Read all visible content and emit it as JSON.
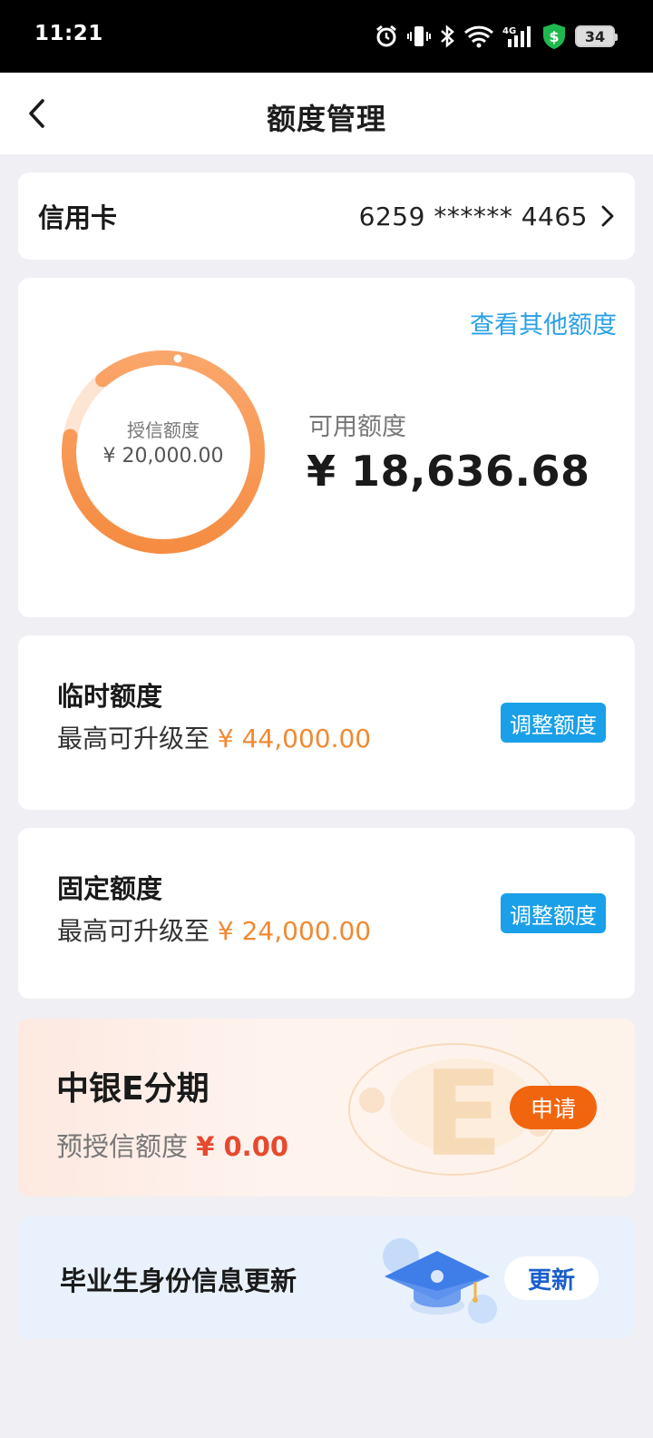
{
  "status_bar": {
    "time": "11:21",
    "battery": "34",
    "icons": [
      "alarm-icon",
      "vibrate-icon",
      "bluetooth-icon",
      "wifi-icon",
      "signal-4g-icon",
      "shield-dollar-icon",
      "battery-icon"
    ]
  },
  "nav": {
    "back_icon": "chevron-left-icon",
    "title": "额度管理"
  },
  "card_selector": {
    "label": "信用卡",
    "number": "6259 ****** 4465"
  },
  "limit_summary": {
    "other_limits_link": "查看其他额度",
    "credit_label": "授信额度",
    "credit_value": "¥ 20,000.00",
    "available_label": "可用额度",
    "available_value": "¥ 18,636.68",
    "ring_colors": {
      "track": "#fde4d3",
      "fill_start": "#f58b3a",
      "fill_end": "#fbb07a"
    }
  },
  "temporary_limit": {
    "title": "临时额度",
    "desc_prefix": "最高可升级至 ",
    "amount": "¥ 44,000.00",
    "button": "调整额度"
  },
  "fixed_limit": {
    "title": "固定额度",
    "desc_prefix": "最高可升级至 ",
    "amount": "¥ 24,000.00",
    "button": "调整额度"
  },
  "installment_promo": {
    "title": "中银E分期",
    "desc_prefix": "预授信额度 ",
    "amount": "¥ 0.00",
    "button": "申请"
  },
  "graduate_update": {
    "title": "毕业生身份信息更新",
    "button": "更新"
  },
  "colors": {
    "accent_blue": "#1aa0e8",
    "link_blue": "#2aa0e6",
    "amount_orange": "#f08a33",
    "apply_orange": "#f2650f",
    "promo_red": "#e64a2e"
  }
}
